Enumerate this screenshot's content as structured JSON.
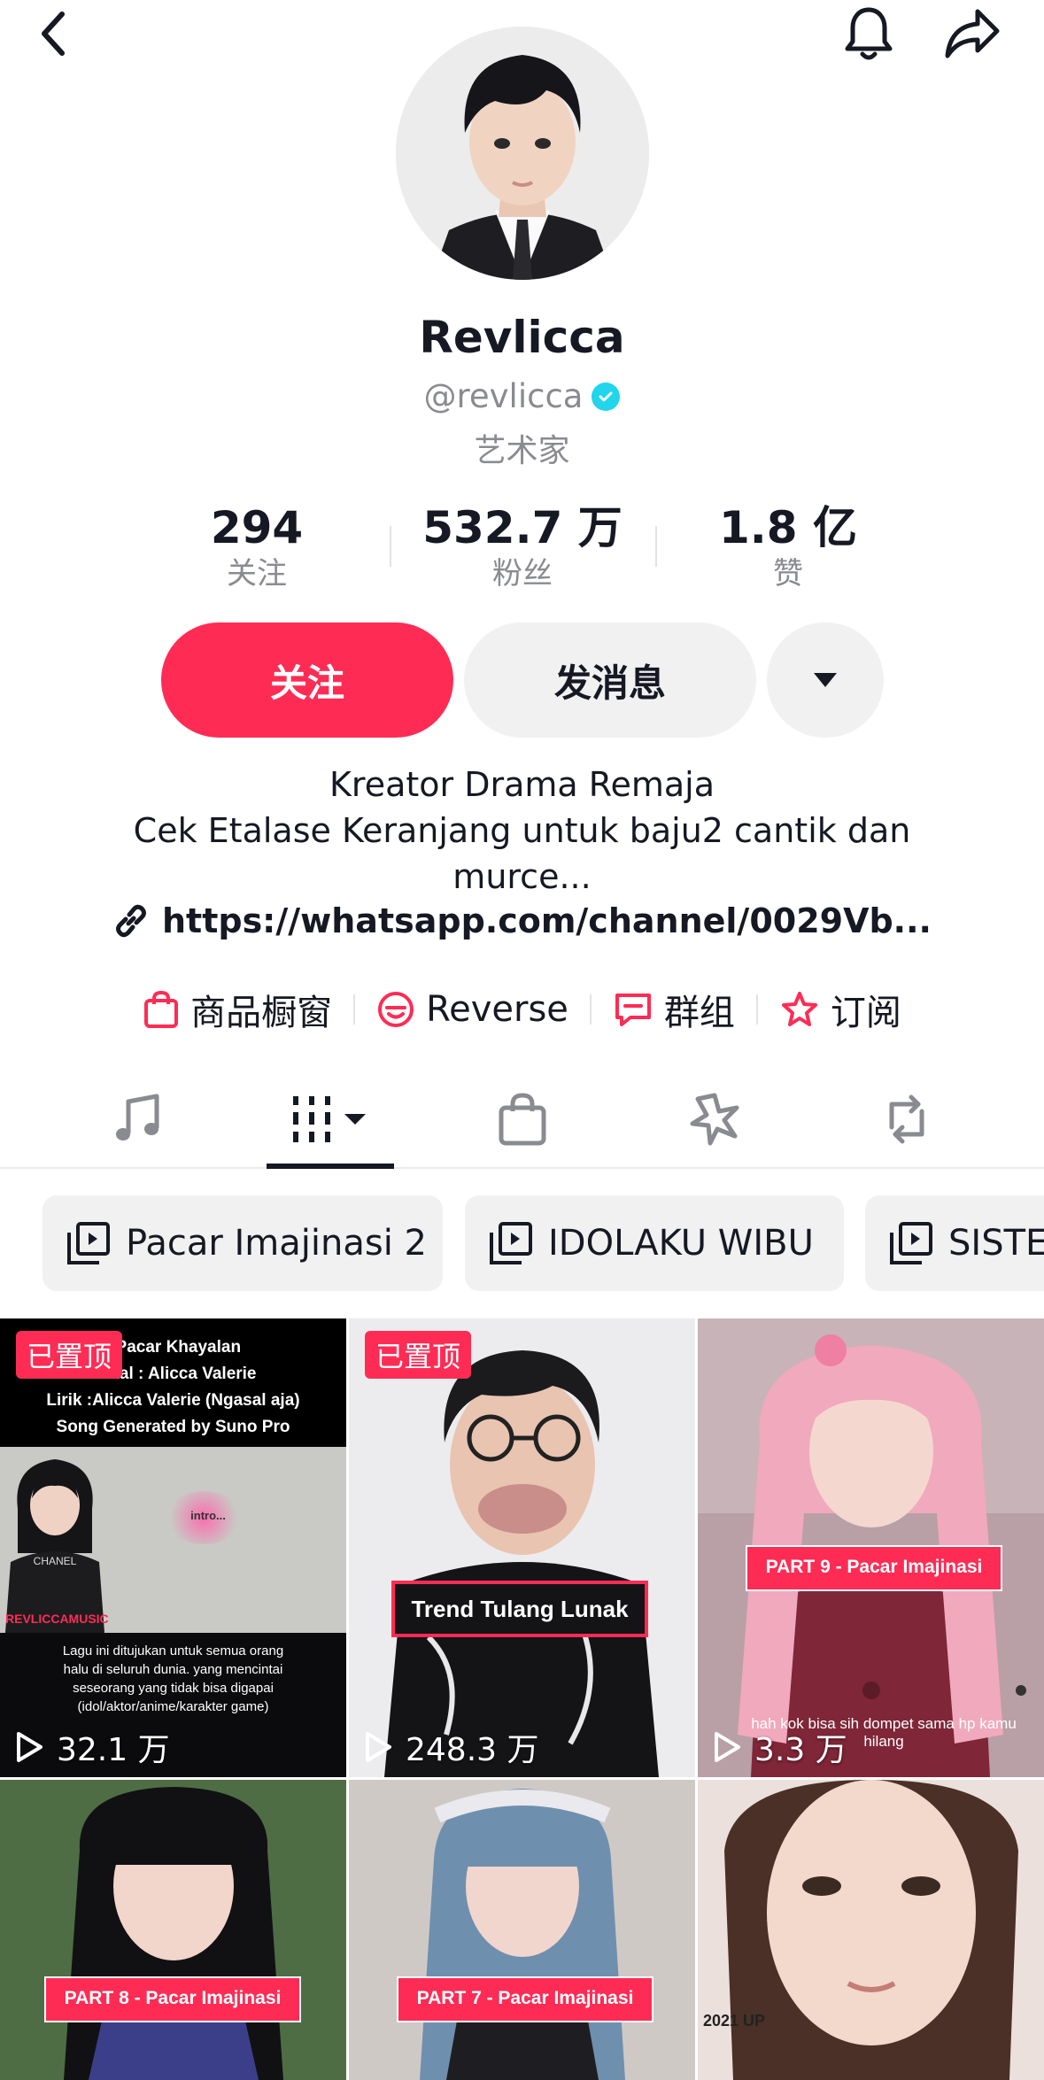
{
  "profile": {
    "name": "Revlicca",
    "handle": "@revlicca",
    "category": "艺术家",
    "stats": [
      {
        "value": "294",
        "label": "关注"
      },
      {
        "value": "532.7 万",
        "label": "粉丝"
      },
      {
        "value": "1.8 亿",
        "label": "赞"
      }
    ],
    "bio_lines": [
      "Kreator Drama Remaja",
      "Cek Etalase Keranjang untuk baju2 cantik dan",
      "murce..."
    ],
    "link": "https://whatsapp.com/channel/0029Vb..."
  },
  "actions": {
    "follow": "关注",
    "message": "发消息"
  },
  "features": [
    {
      "label": "商品橱窗",
      "icon": "shopping-bag-icon"
    },
    {
      "label": "Reverse",
      "icon": "reverse-icon"
    },
    {
      "label": "群组",
      "icon": "chat-bubble-icon"
    },
    {
      "label": "订阅",
      "icon": "star-subscribe-icon"
    }
  ],
  "tabs": [
    "music-icon",
    "videos-grid-icon",
    "shop-icon",
    "sparkle-icon",
    "repost-icon"
  ],
  "playlists": [
    "Pacar Imajinasi 2",
    "IDOLAKU WIBU",
    "SISTE"
  ],
  "videos": [
    {
      "pinned": "已置顶",
      "views": "32.1 万",
      "overlay_lines": [
        ": Pacar Khayalan",
        "Vokal : Alicca Valerie",
        "Lirik :Alicca Valerie (Ngasal aja)",
        "Song Generated by Suno Pro"
      ],
      "intro": "intro...",
      "shirt": "CHANEL",
      "tag": "REVLICCAMUSIC",
      "caption": [
        "Lagu ini ditujukan untuk semua orang",
        "halu di seluruh dunia. yang mencintai",
        "seseorang yang tidak bisa digapai",
        "(idol/aktor/anime/karakter game)"
      ]
    },
    {
      "pinned": "已置顶",
      "views": "248.3 万",
      "title": "Trend Tulang Lunak"
    },
    {
      "views": "3.3 万",
      "title": "PART 9 - Pacar Imajinasi",
      "caption": "hah kok bisa sih dompet sama hp kamu hilang"
    },
    {
      "title": "PART 8 - Pacar Imajinasi"
    },
    {
      "title": "PART 7 - Pacar Imajinasi"
    },
    {
      "caption": "2021 UP"
    }
  ],
  "colors": {
    "accent": "#fe2c55",
    "verified": "#20d5ec",
    "muted": "#8a8b91",
    "chip_bg": "#f1f1f2"
  }
}
